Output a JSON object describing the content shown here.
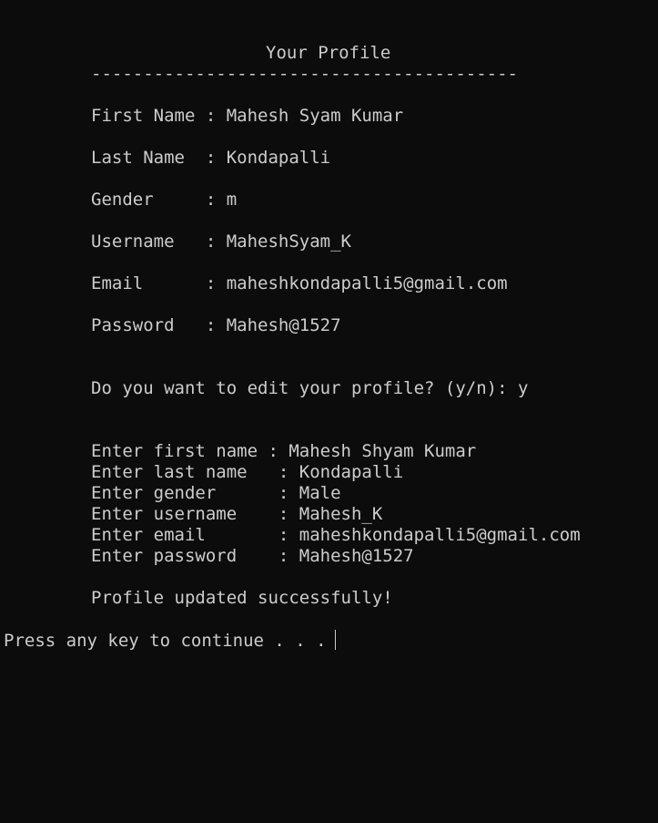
{
  "window": {
    "background": "#0c0c0c",
    "text_color": "#cccccc"
  },
  "profile": {
    "title": "Your Profile",
    "divider": "-----------------------------------------",
    "fields": [
      {
        "label": "First Name : ",
        "value": "Mahesh Syam Kumar"
      },
      {
        "label": "Last Name  : ",
        "value": "Kondapalli"
      },
      {
        "label": "Gender     : ",
        "value": "m"
      },
      {
        "label": "Username   : ",
        "value": "MaheshSyam_K"
      },
      {
        "label": "Email      : ",
        "value": "maheshkondapalli5@gmail.com"
      },
      {
        "label": "Password   : ",
        "value": "Mahesh@1527"
      }
    ]
  },
  "edit_prompt": {
    "question": "Do you want to edit your profile? (y/n): ",
    "answer": "y"
  },
  "edit_inputs": [
    {
      "label": "Enter first name : ",
      "value": "Mahesh Shyam Kumar"
    },
    {
      "label": "Enter last name   : ",
      "value": "Kondapalli"
    },
    {
      "label": "Enter gender      : ",
      "value": "Male"
    },
    {
      "label": "Enter username    : ",
      "value": "Mahesh_K"
    },
    {
      "label": "Enter email       : ",
      "value": "maheshkondapalli5@gmail.com"
    },
    {
      "label": "Enter password    : ",
      "value": "Mahesh@1527"
    }
  ],
  "status": {
    "success_message": "Profile updated successfully!",
    "continue_prompt": "Press any key to continue . . ."
  }
}
